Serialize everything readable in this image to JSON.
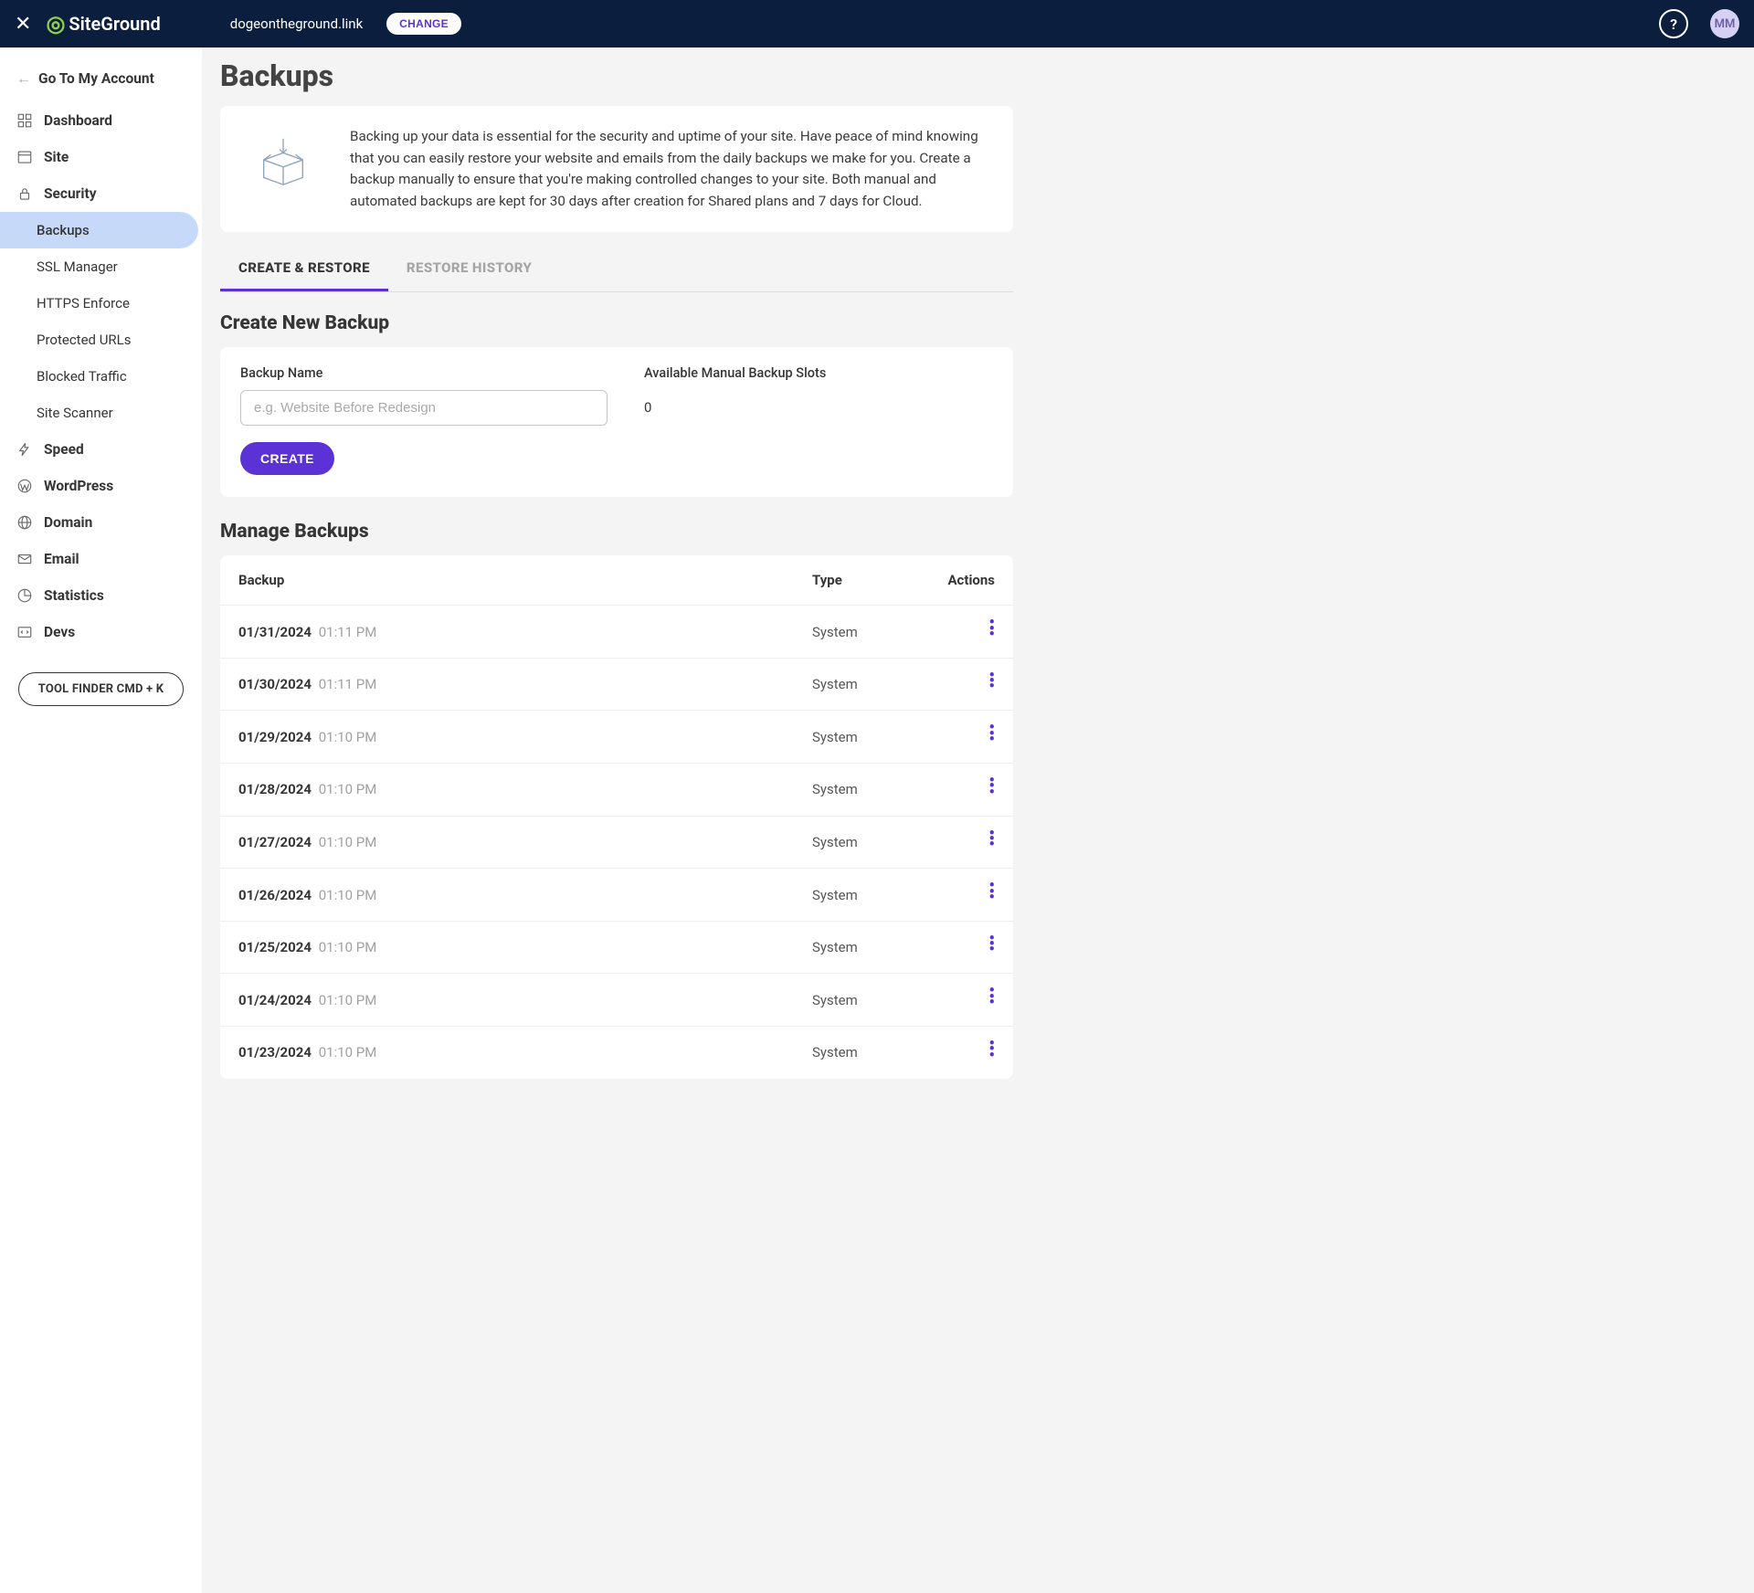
{
  "header": {
    "logo_text": "SiteGround",
    "site_name": "dogeontheground.link",
    "change_label": "CHANGE",
    "avatar_initials": "MM"
  },
  "sidebar": {
    "back_label": "Go To My Account",
    "items": [
      {
        "label": "Dashboard",
        "icon": "dashboard"
      },
      {
        "label": "Site",
        "icon": "site"
      },
      {
        "label": "Security",
        "icon": "security"
      },
      {
        "label": "Speed",
        "icon": "speed"
      },
      {
        "label": "WordPress",
        "icon": "wordpress"
      },
      {
        "label": "Domain",
        "icon": "domain"
      },
      {
        "label": "Email",
        "icon": "email"
      },
      {
        "label": "Statistics",
        "icon": "statistics"
      },
      {
        "label": "Devs",
        "icon": "devs"
      }
    ],
    "security_sub": [
      {
        "label": "Backups",
        "active": true
      },
      {
        "label": "SSL Manager"
      },
      {
        "label": "HTTPS Enforce"
      },
      {
        "label": "Protected URLs"
      },
      {
        "label": "Blocked Traffic"
      },
      {
        "label": "Site Scanner"
      }
    ],
    "tool_finder": "TOOL FINDER CMD + K"
  },
  "page": {
    "title": "Backups",
    "intro": "Backing up your data is essential for the security and uptime of your site. Have peace of mind knowing that you can easily restore your website and emails from the daily backups we make for you. Create a backup manually to ensure that you're making controlled changes to your site. Both manual and automated backups are kept for 30 days after creation for Shared plans and 7 days for Cloud.",
    "tabs": [
      {
        "label": "CREATE & RESTORE",
        "active": true
      },
      {
        "label": "RESTORE HISTORY"
      }
    ],
    "create": {
      "section_title": "Create New Backup",
      "name_label": "Backup Name",
      "name_placeholder": "e.g. Website Before Redesign",
      "slots_label": "Available Manual Backup Slots",
      "slots_value": "0",
      "button": "CREATE"
    },
    "manage": {
      "section_title": "Manage Backups",
      "col_backup": "Backup",
      "col_type": "Type",
      "col_actions": "Actions",
      "rows": [
        {
          "date": "01/31/2024",
          "time": "01:11 PM",
          "type": "System"
        },
        {
          "date": "01/30/2024",
          "time": "01:11 PM",
          "type": "System"
        },
        {
          "date": "01/29/2024",
          "time": "01:10 PM",
          "type": "System"
        },
        {
          "date": "01/28/2024",
          "time": "01:10 PM",
          "type": "System"
        },
        {
          "date": "01/27/2024",
          "time": "01:10 PM",
          "type": "System"
        },
        {
          "date": "01/26/2024",
          "time": "01:10 PM",
          "type": "System"
        },
        {
          "date": "01/25/2024",
          "time": "01:10 PM",
          "type": "System"
        },
        {
          "date": "01/24/2024",
          "time": "01:10 PM",
          "type": "System"
        },
        {
          "date": "01/23/2024",
          "time": "01:10 PM",
          "type": "System"
        }
      ]
    }
  }
}
